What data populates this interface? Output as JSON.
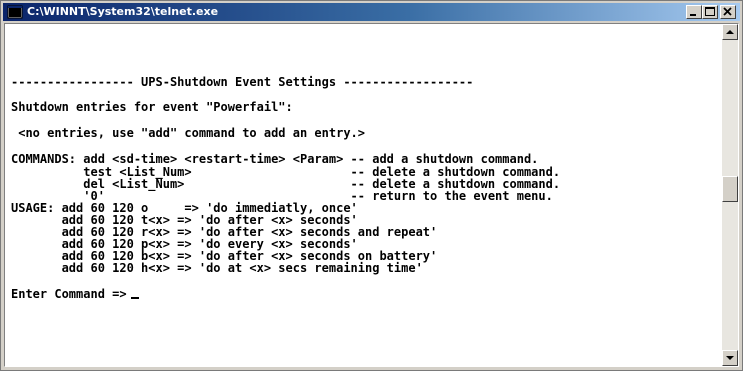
{
  "window": {
    "title": "C:\\WINNT\\System32\\telnet.exe",
    "icons": {
      "app": "console-app-icon",
      "minimize": "minimize-icon",
      "maximize": "maximize-icon",
      "close": "close-icon"
    }
  },
  "console": {
    "lines": [
      "----------------- UPS-Shutdown Event Settings ------------------",
      "Shutdown entries for event \"Powerfail\":",
      " <no entries, use \"add\" command to add an entry.>",
      "COMMANDS: add <sd-time> <restart-time> <Param> -- add a shutdown command.",
      "          test <List_Num>                      -- delete a shutdown command.",
      "          del <List_Num>                       -- delete a shutdown command.",
      "          '0'                                  -- return to the event menu.",
      "USAGE: add 60 120 o     => 'do immediatly, once'",
      "       add 60 120 t<x> => 'do after <x> seconds'",
      "       add 60 120 r<x> => 'do after <x> seconds and repeat'",
      "       add 60 120 p<x> => 'do every <x> seconds'",
      "       add 60 120 b<x> => 'do after <x> seconds on battery'",
      "       add 60 120 h<x> => 'do at <x> secs remaining time'",
      "Enter Command =>"
    ]
  },
  "scrollbar": {
    "up_icon": "scroll-up-arrow-icon",
    "down_icon": "scroll-down-arrow-icon"
  }
}
